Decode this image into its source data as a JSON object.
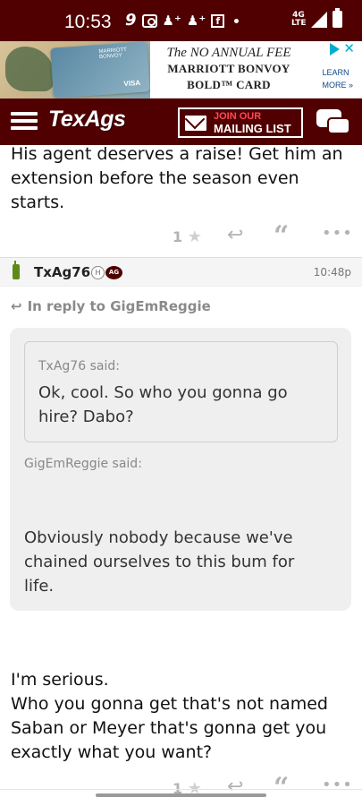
{
  "status_bar": {
    "time": "10:53",
    "icons": [
      "nine-icon",
      "camera-box-icon",
      "add-person-icon",
      "add-person-icon",
      "facebook-icon",
      "dot-icon"
    ],
    "network": "4G LTE",
    "colors": {
      "background": "#500000"
    }
  },
  "ad": {
    "headline": "The NO ANNUAL FEE",
    "line1": "MARRIOTT BONVOY",
    "line2": "BOLD™ CARD",
    "cta_line1": "LEARN",
    "cta_line2": "MORE »",
    "card_brand": "MARRIOTT BONVOY",
    "card_network": "VISA"
  },
  "header": {
    "logo": "TexAgs",
    "mailing_top": "JOIN OUR",
    "mailing_bottom": "MAILING LIST",
    "colors": {
      "maroon": "#500000"
    }
  },
  "top_post": {
    "line1": "His agent deserves a raise! Get him an",
    "line2": "extension before the season even",
    "line3": "starts.",
    "likes": "1"
  },
  "reply_post": {
    "username": "TxAg76",
    "badge_h": "H",
    "badge_ag": "AG",
    "time": "10:48p",
    "in_reply_to": "In reply to GigEmReggie",
    "inner_quote": {
      "author": "TxAg76 said:",
      "line1": "Ok, cool. So who you gonna go",
      "line2": "hire? Dabo?"
    },
    "outer_quote": {
      "author": "GigEmReggie said:",
      "line1": "Obviously nobody because we've",
      "line2": "chained ourselves to this bum for",
      "line3": "life."
    },
    "body": {
      "line1": "I'm serious.",
      "line2": "Who you gonna get that's not named",
      "line3": "Saban or Meyer that's gonna get you",
      "line4": "exactly what you want?"
    },
    "likes": "1"
  }
}
